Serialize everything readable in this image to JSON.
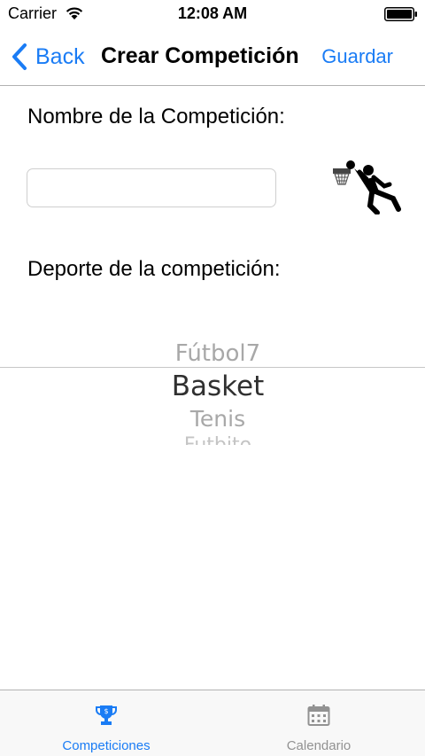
{
  "status_bar": {
    "carrier": "Carrier",
    "time": "12:08 AM"
  },
  "nav": {
    "back_label": "Back",
    "title": "Crear Competición",
    "save_label": "Guardar"
  },
  "form": {
    "name_label": "Nombre de la Competición:",
    "name_value": "",
    "sport_label": "Deporte de la competición:"
  },
  "picker": {
    "visible_options": [
      "Fútbol7",
      "Basket",
      "Tenis",
      "Futbito"
    ],
    "selected": "Basket"
  },
  "tabs": [
    {
      "label": "Competiciones",
      "icon": "trophy-icon",
      "active": true
    },
    {
      "label": "Calendario",
      "icon": "calendar-icon",
      "active": false
    }
  ],
  "colors": {
    "accent": "#1a7cf5",
    "inactive": "#929292",
    "separator": "#b2b2b2"
  }
}
